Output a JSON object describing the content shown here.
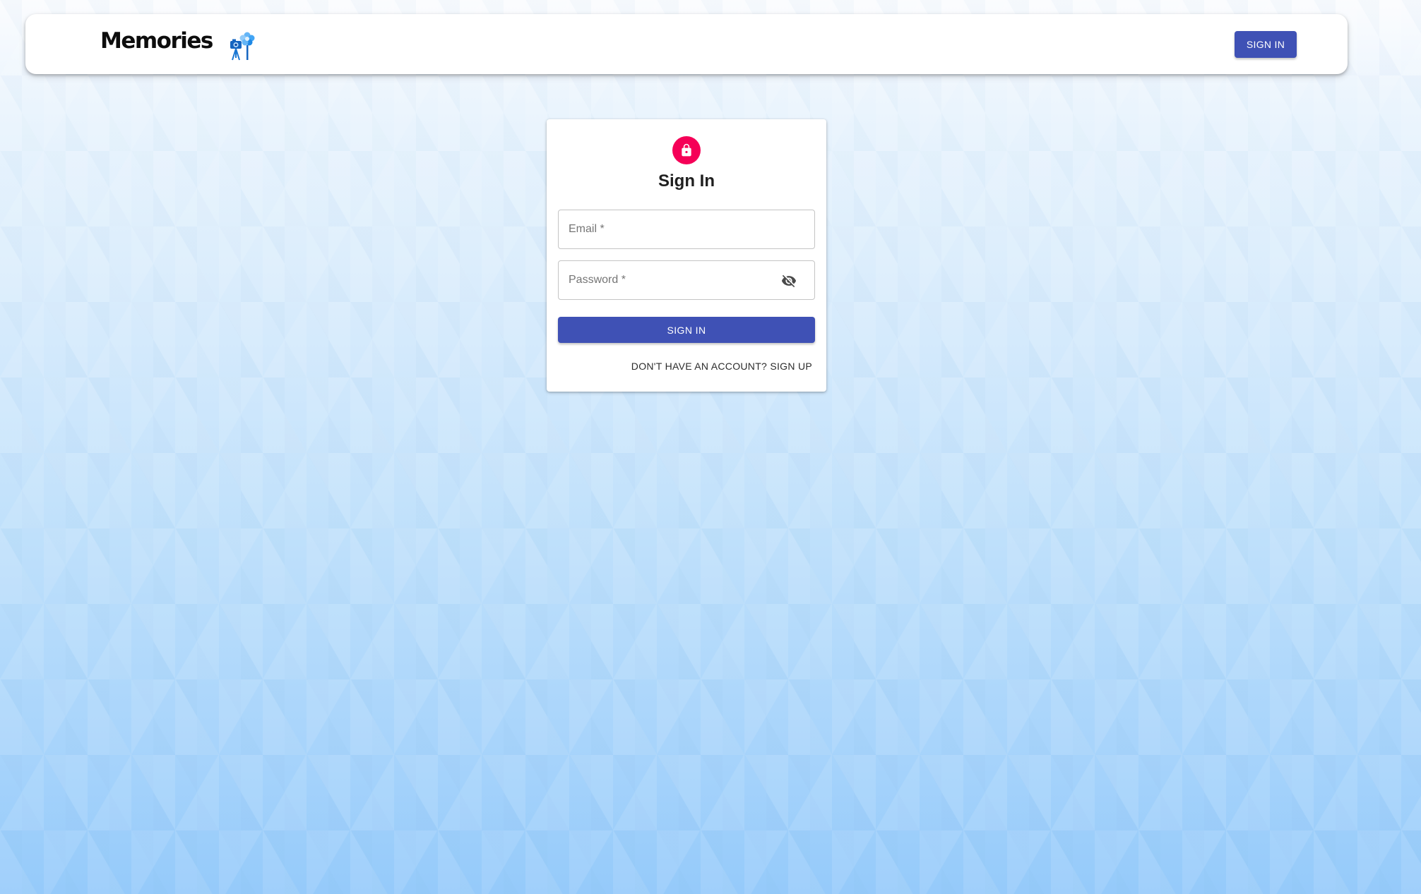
{
  "header": {
    "brand": "Memories",
    "logo_icon": "memories-camera-tripod-icon",
    "signin_label": "SIGN IN"
  },
  "auth_form": {
    "avatar_icon": "lock-icon",
    "avatar_color": "#f50057",
    "title": "Sign In",
    "email_placeholder": "Email *",
    "email_value": "",
    "password_placeholder": "Password *",
    "password_value": "",
    "visibility_icon": "eye-off-icon",
    "submit_label": "SIGN IN",
    "switch_label": "DON'T HAVE AN ACCOUNT? SIGN UP"
  },
  "colors": {
    "primary": "#3f51b5",
    "secondary": "#f50057"
  }
}
